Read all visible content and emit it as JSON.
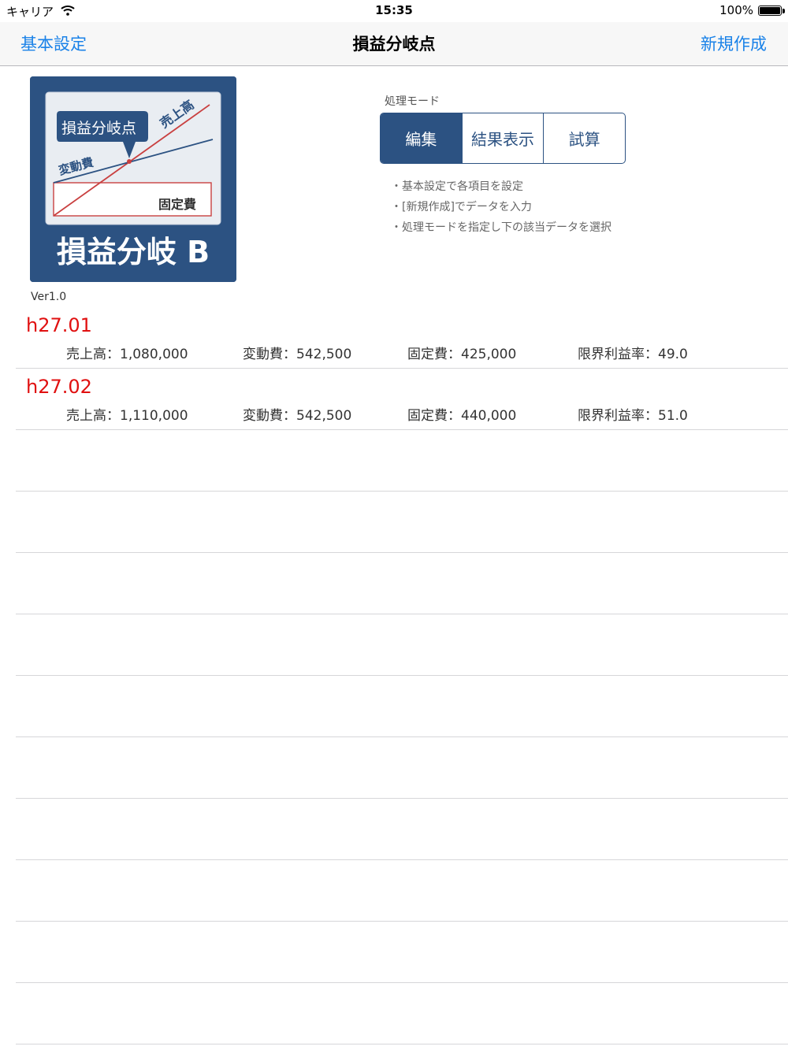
{
  "status_bar": {
    "carrier": "キャリア",
    "time": "15:35",
    "battery": "100%",
    "battery_level": 1.0
  },
  "nav": {
    "left_button": "基本設定",
    "title": "損益分岐点",
    "right_button": "新規作成"
  },
  "app_icon": {
    "callout": "損益分岐点",
    "sales_label": "売上高",
    "variable_label": "変動費",
    "fixed_label": "固定費",
    "name": "損益分岐 B"
  },
  "version": "Ver1.0",
  "mode": {
    "label": "処理モード",
    "segments": [
      "編集",
      "結果表示",
      "試算"
    ],
    "selected_index": 0
  },
  "hints": [
    "・基本設定で各項目を設定",
    "・[新規作成]でデータを入力",
    "・処理モードを指定し下の該当データを選択"
  ],
  "records": [
    {
      "title": "h27.01",
      "sales": "売上高：1,080,000",
      "variable": "変動費：542,500",
      "fixed": "固定費：425,000",
      "margin": "限界利益率：49.0"
    },
    {
      "title": "h27.02",
      "sales": "売上高：1,110,000",
      "variable": "変動費：542,500",
      "fixed": "固定費：440,000",
      "margin": "限界利益率：51.0"
    }
  ],
  "colors": {
    "accent": "#1a82e8",
    "theme": "#2c5282",
    "record_title": "#e01010"
  }
}
